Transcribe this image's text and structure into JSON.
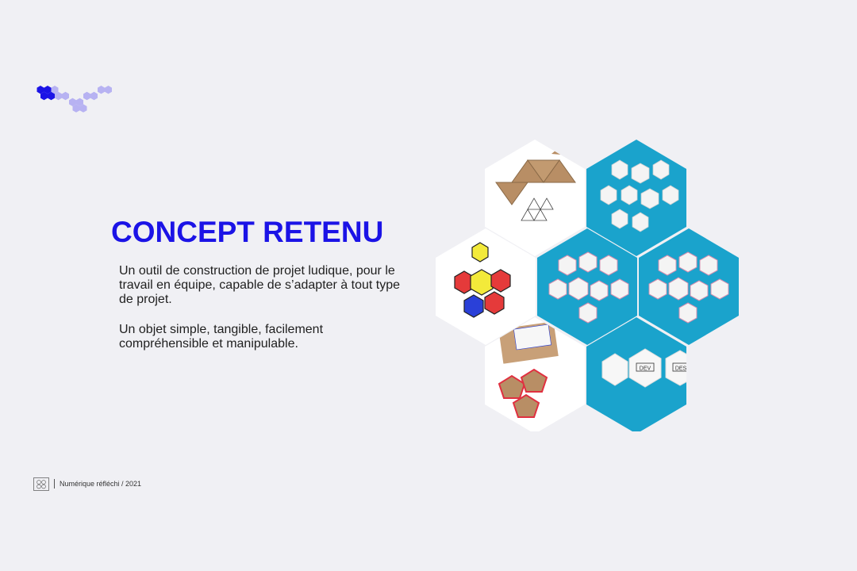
{
  "slide": {
    "title": "CONCEPT RETENU",
    "paragraphs": [
      "Un outil de construction de projet ludique, pour le travail en équipe, capable de s’adapter à tout type de projet.",
      "Un objet simple, tangible, facilement compréhensible et manipulable."
    ]
  },
  "collage": {
    "photo_labels": [
      "DEV",
      "DESI"
    ]
  },
  "footer": {
    "text": "Numérique réfléchi / 2021"
  },
  "colors": {
    "accent": "#1b13e6",
    "accent_light": "#b7b2f2",
    "background": "#f0f0f4",
    "photo_blue": "#1aa3cc",
    "cardboard": "#b88e65"
  },
  "icons": [
    "hexagon-cluster-logo",
    "footer-logo-icon"
  ]
}
